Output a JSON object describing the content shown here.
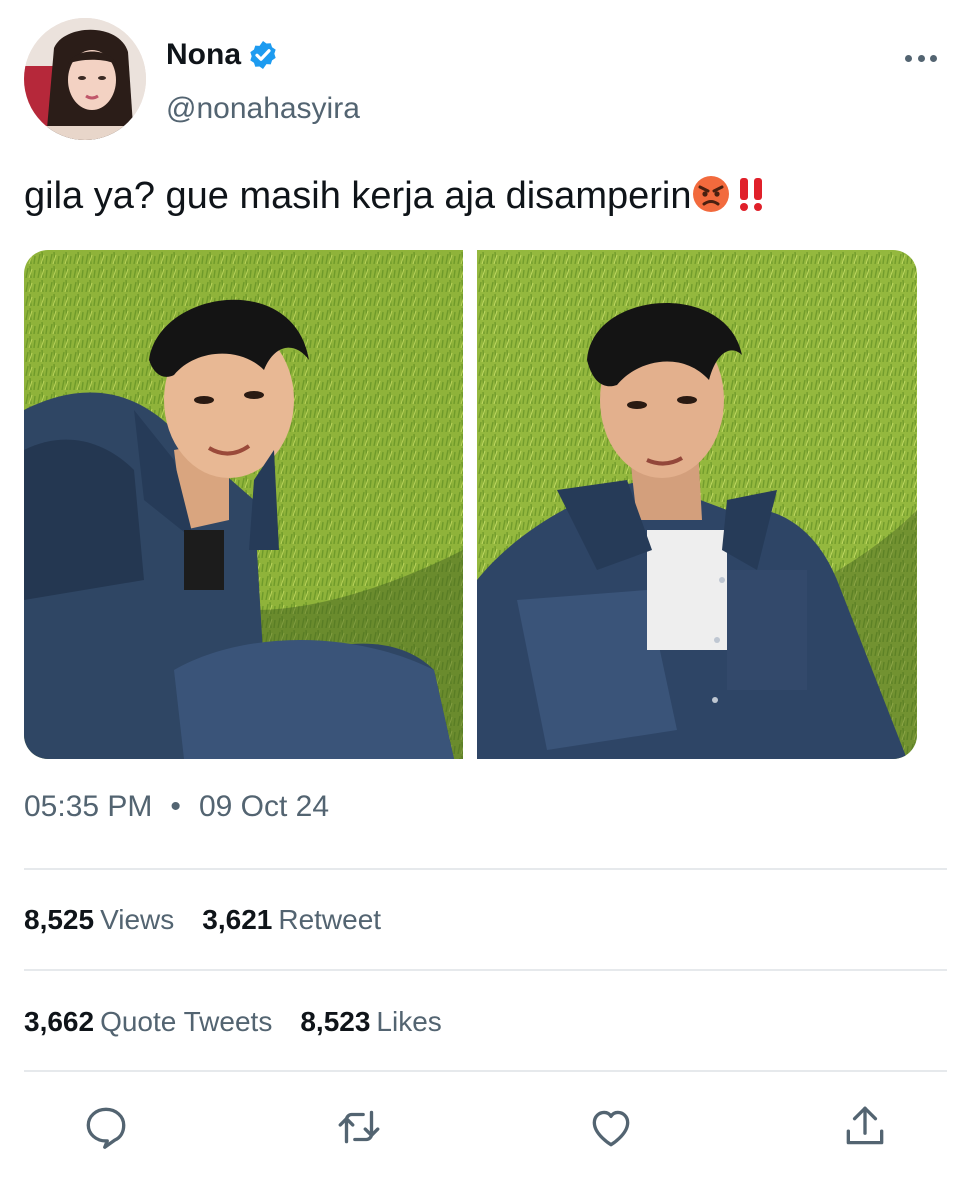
{
  "user": {
    "display_name": "Nona",
    "handle": "@nonahasyira",
    "verified": true
  },
  "tweet": {
    "text": "gila ya? gue masih kerja aja disamperin",
    "emoji": [
      "angry-face-emoji",
      "double-exclamation-emoji"
    ],
    "time": "05:35 PM",
    "separator": "•",
    "date": "09 Oct 24"
  },
  "stats": {
    "views": {
      "count": "8,525",
      "label": "Views"
    },
    "retweets": {
      "count": "3,621",
      "label": "Retweet"
    },
    "quotes": {
      "count": "3,662",
      "label": "Quote Tweets"
    },
    "likes": {
      "count": "8,523",
      "label": "Likes"
    }
  },
  "icons": {
    "reply": "reply-icon",
    "retweet": "retweet-icon",
    "like": "like-icon",
    "share": "share-icon",
    "more": "more-icon",
    "verified": "verified-badge-icon"
  },
  "colors": {
    "text": "#0f1419",
    "secondary": "#536471",
    "verified": "#1d9bf0",
    "divider": "#e6e9ec",
    "emoji_red": "#e0202a"
  }
}
